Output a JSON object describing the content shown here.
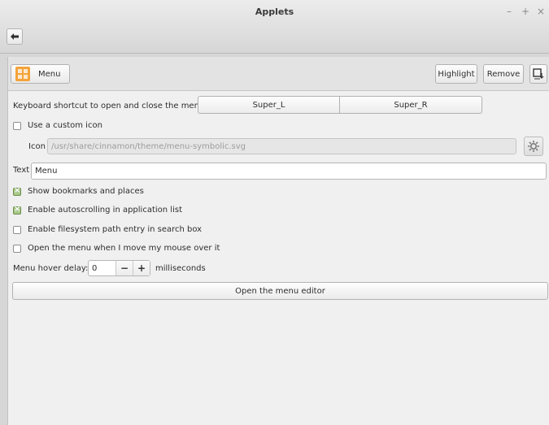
{
  "window": {
    "title": "Applets"
  },
  "controls": {
    "minimize": "–",
    "maximize": "+",
    "close": "×"
  },
  "toolbar": {
    "applet_label": "Menu",
    "highlight_label": "Highlight",
    "remove_label": "Remove"
  },
  "settings": {
    "shortcut_label": "Keyboard shortcut to open and close the menu",
    "shortcut_primary": "Super_L",
    "shortcut_secondary": "Super_R",
    "custom_icon_label": "Use a custom icon",
    "custom_icon_checked": false,
    "icon_label": "Icon",
    "icon_value": "/usr/share/cinnamon/theme/menu-symbolic.svg",
    "text_label": "Text",
    "text_value": "Menu",
    "bookmarks_label": "Show bookmarks and places",
    "bookmarks_checked": true,
    "autoscroll_label": "Enable autoscrolling in application list",
    "autoscroll_checked": true,
    "filesystem_label": "Enable filesystem path entry in search box",
    "filesystem_checked": false,
    "hover_open_label": "Open the menu when I move my mouse over it",
    "hover_open_checked": false,
    "hover_delay_label": "Menu hover delay:",
    "hover_delay_value": "0",
    "hover_delay_unit": "milliseconds",
    "spin_minus": "−",
    "spin_plus": "+",
    "editor_button": "Open the menu editor"
  },
  "colors": {
    "accent_check": "#a9c98a",
    "menu_logo": "#f3a33a"
  }
}
